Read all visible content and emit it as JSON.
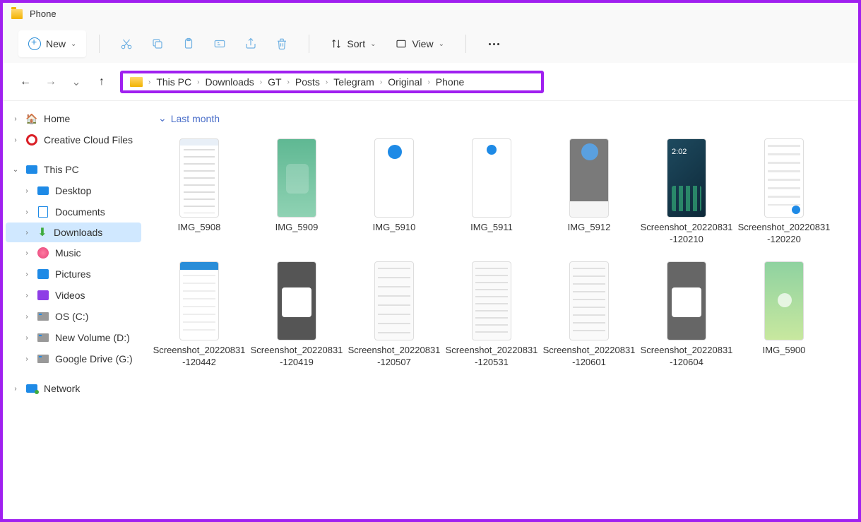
{
  "title": "Phone",
  "toolbar": {
    "new": "New",
    "sort": "Sort",
    "view": "View"
  },
  "breadcrumb": [
    "This PC",
    "Downloads",
    "GT",
    "Posts",
    "Telegram",
    "Original",
    "Phone"
  ],
  "sidebar": {
    "home": "Home",
    "creative_cloud": "Creative Cloud Files",
    "this_pc": "This PC",
    "desktop": "Desktop",
    "documents": "Documents",
    "downloads": "Downloads",
    "music": "Music",
    "pictures": "Pictures",
    "videos": "Videos",
    "os_c": "OS (C:)",
    "new_volume_d": "New Volume (D:)",
    "google_drive_g": "Google Drive (G:)",
    "network": "Network"
  },
  "group": "Last month",
  "files": [
    {
      "name": "IMG_5908",
      "thumb": "t0"
    },
    {
      "name": "IMG_5909",
      "thumb": "t1"
    },
    {
      "name": "IMG_5910",
      "thumb": "t2"
    },
    {
      "name": "IMG_5911",
      "thumb": "t3"
    },
    {
      "name": "IMG_5912",
      "thumb": "t4"
    },
    {
      "name": "Screenshot_20220831-120210",
      "thumb": "t5"
    },
    {
      "name": "Screenshot_20220831-120220",
      "thumb": "t6"
    },
    {
      "name": "Screenshot_20220831-120442",
      "thumb": "t7"
    },
    {
      "name": "Screenshot_20220831-120419",
      "thumb": "t8"
    },
    {
      "name": "Screenshot_20220831-120507",
      "thumb": "t9"
    },
    {
      "name": "Screenshot_20220831-120531",
      "thumb": "t10"
    },
    {
      "name": "Screenshot_20220831-120601",
      "thumb": "t11"
    },
    {
      "name": "Screenshot_20220831-120604",
      "thumb": "t12"
    },
    {
      "name": "IMG_5900",
      "thumb": "t13"
    }
  ]
}
